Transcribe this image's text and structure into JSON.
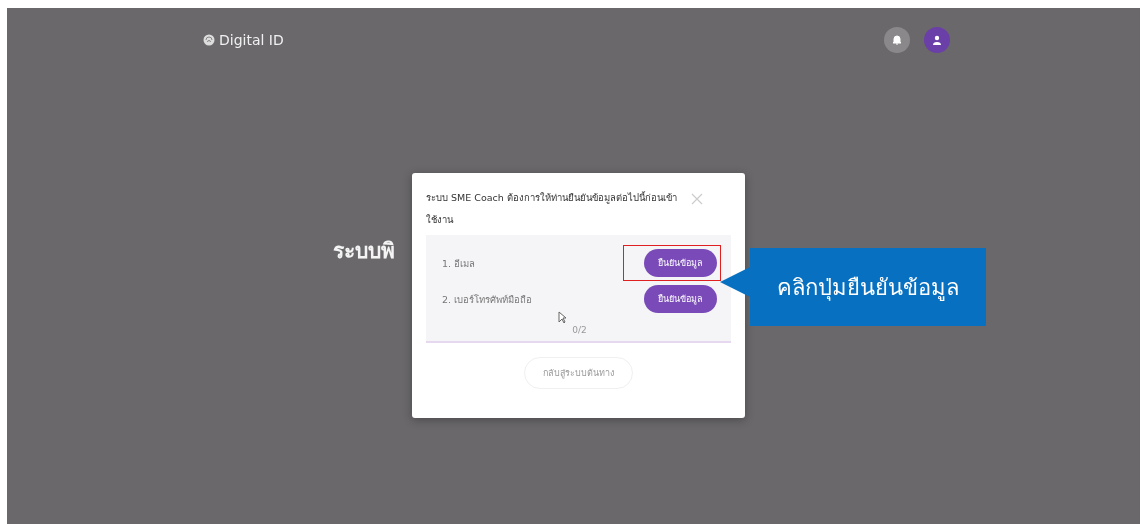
{
  "header": {
    "logo": "Digital ID"
  },
  "page": {
    "heading": "ระบบพิ"
  },
  "dialog": {
    "title": "ระบบ SME Coach ต้องการให้ท่านยืนยันข้อมูลต่อไปนี้ก่อนเข้าใช้งาน",
    "items": [
      {
        "label": "1. อีเมล",
        "button": "ยืนยันข้อมูล",
        "highlighted": true
      },
      {
        "label": "2. เบอร์โทรศัพท์มือถือ",
        "button": "ยืนยันข้อมูล",
        "highlighted": false
      }
    ],
    "counter": "0/2",
    "back_button": "กลับสู่ระบบต้นทาง"
  },
  "callout": {
    "text": "คลิกปุ่มยืนยันข้อมูล"
  }
}
